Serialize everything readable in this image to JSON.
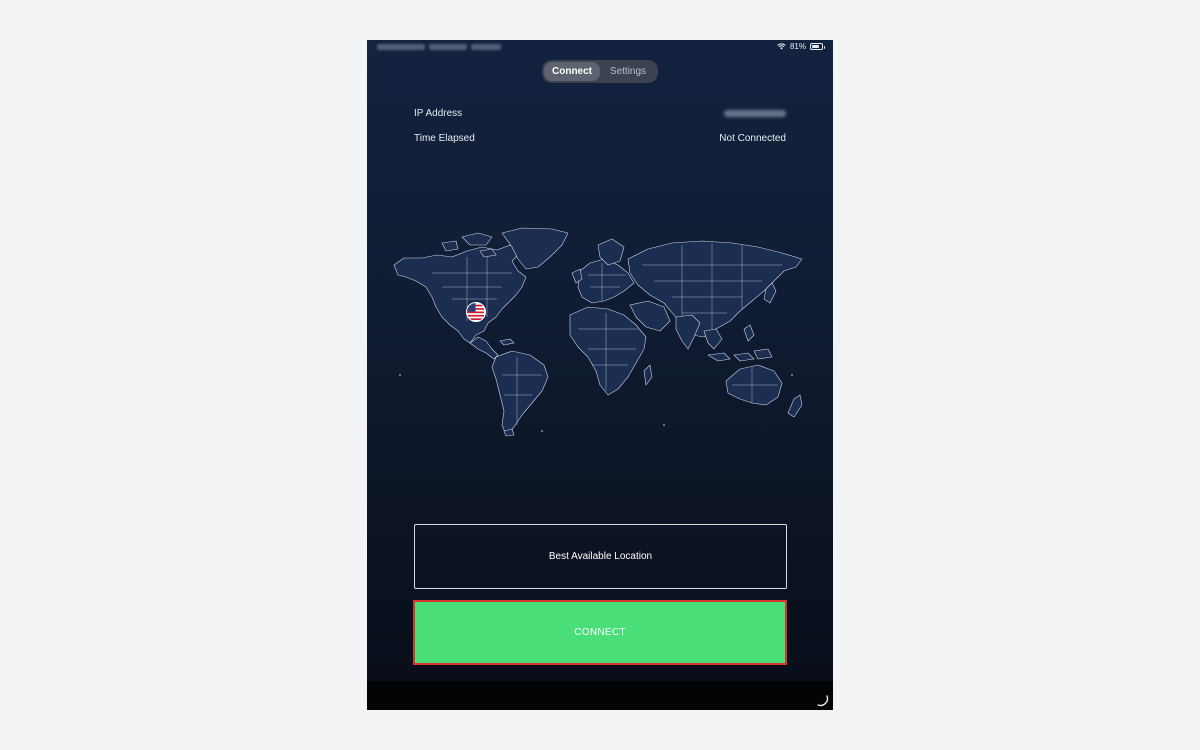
{
  "status_bar": {
    "battery_text": "81%",
    "battery_level": 0.81,
    "wifi_icon": "wifi-icon",
    "battery_icon": "battery-icon"
  },
  "tabs": [
    {
      "label": "Connect",
      "active": true
    },
    {
      "label": "Settings",
      "active": false
    }
  ],
  "info": {
    "ip_label": "IP Address",
    "time_label": "Time Elapsed",
    "time_value": "Not Connected"
  },
  "map": {
    "selected_flag_icon": "us-flag-icon"
  },
  "location": {
    "label": "Best Available Location"
  },
  "connect": {
    "label": "CONNECT"
  },
  "colors": {
    "accent_green": "#49de77",
    "focus_red": "#d9352e",
    "background_top": "#13223f",
    "background_bottom": "#080d18"
  }
}
